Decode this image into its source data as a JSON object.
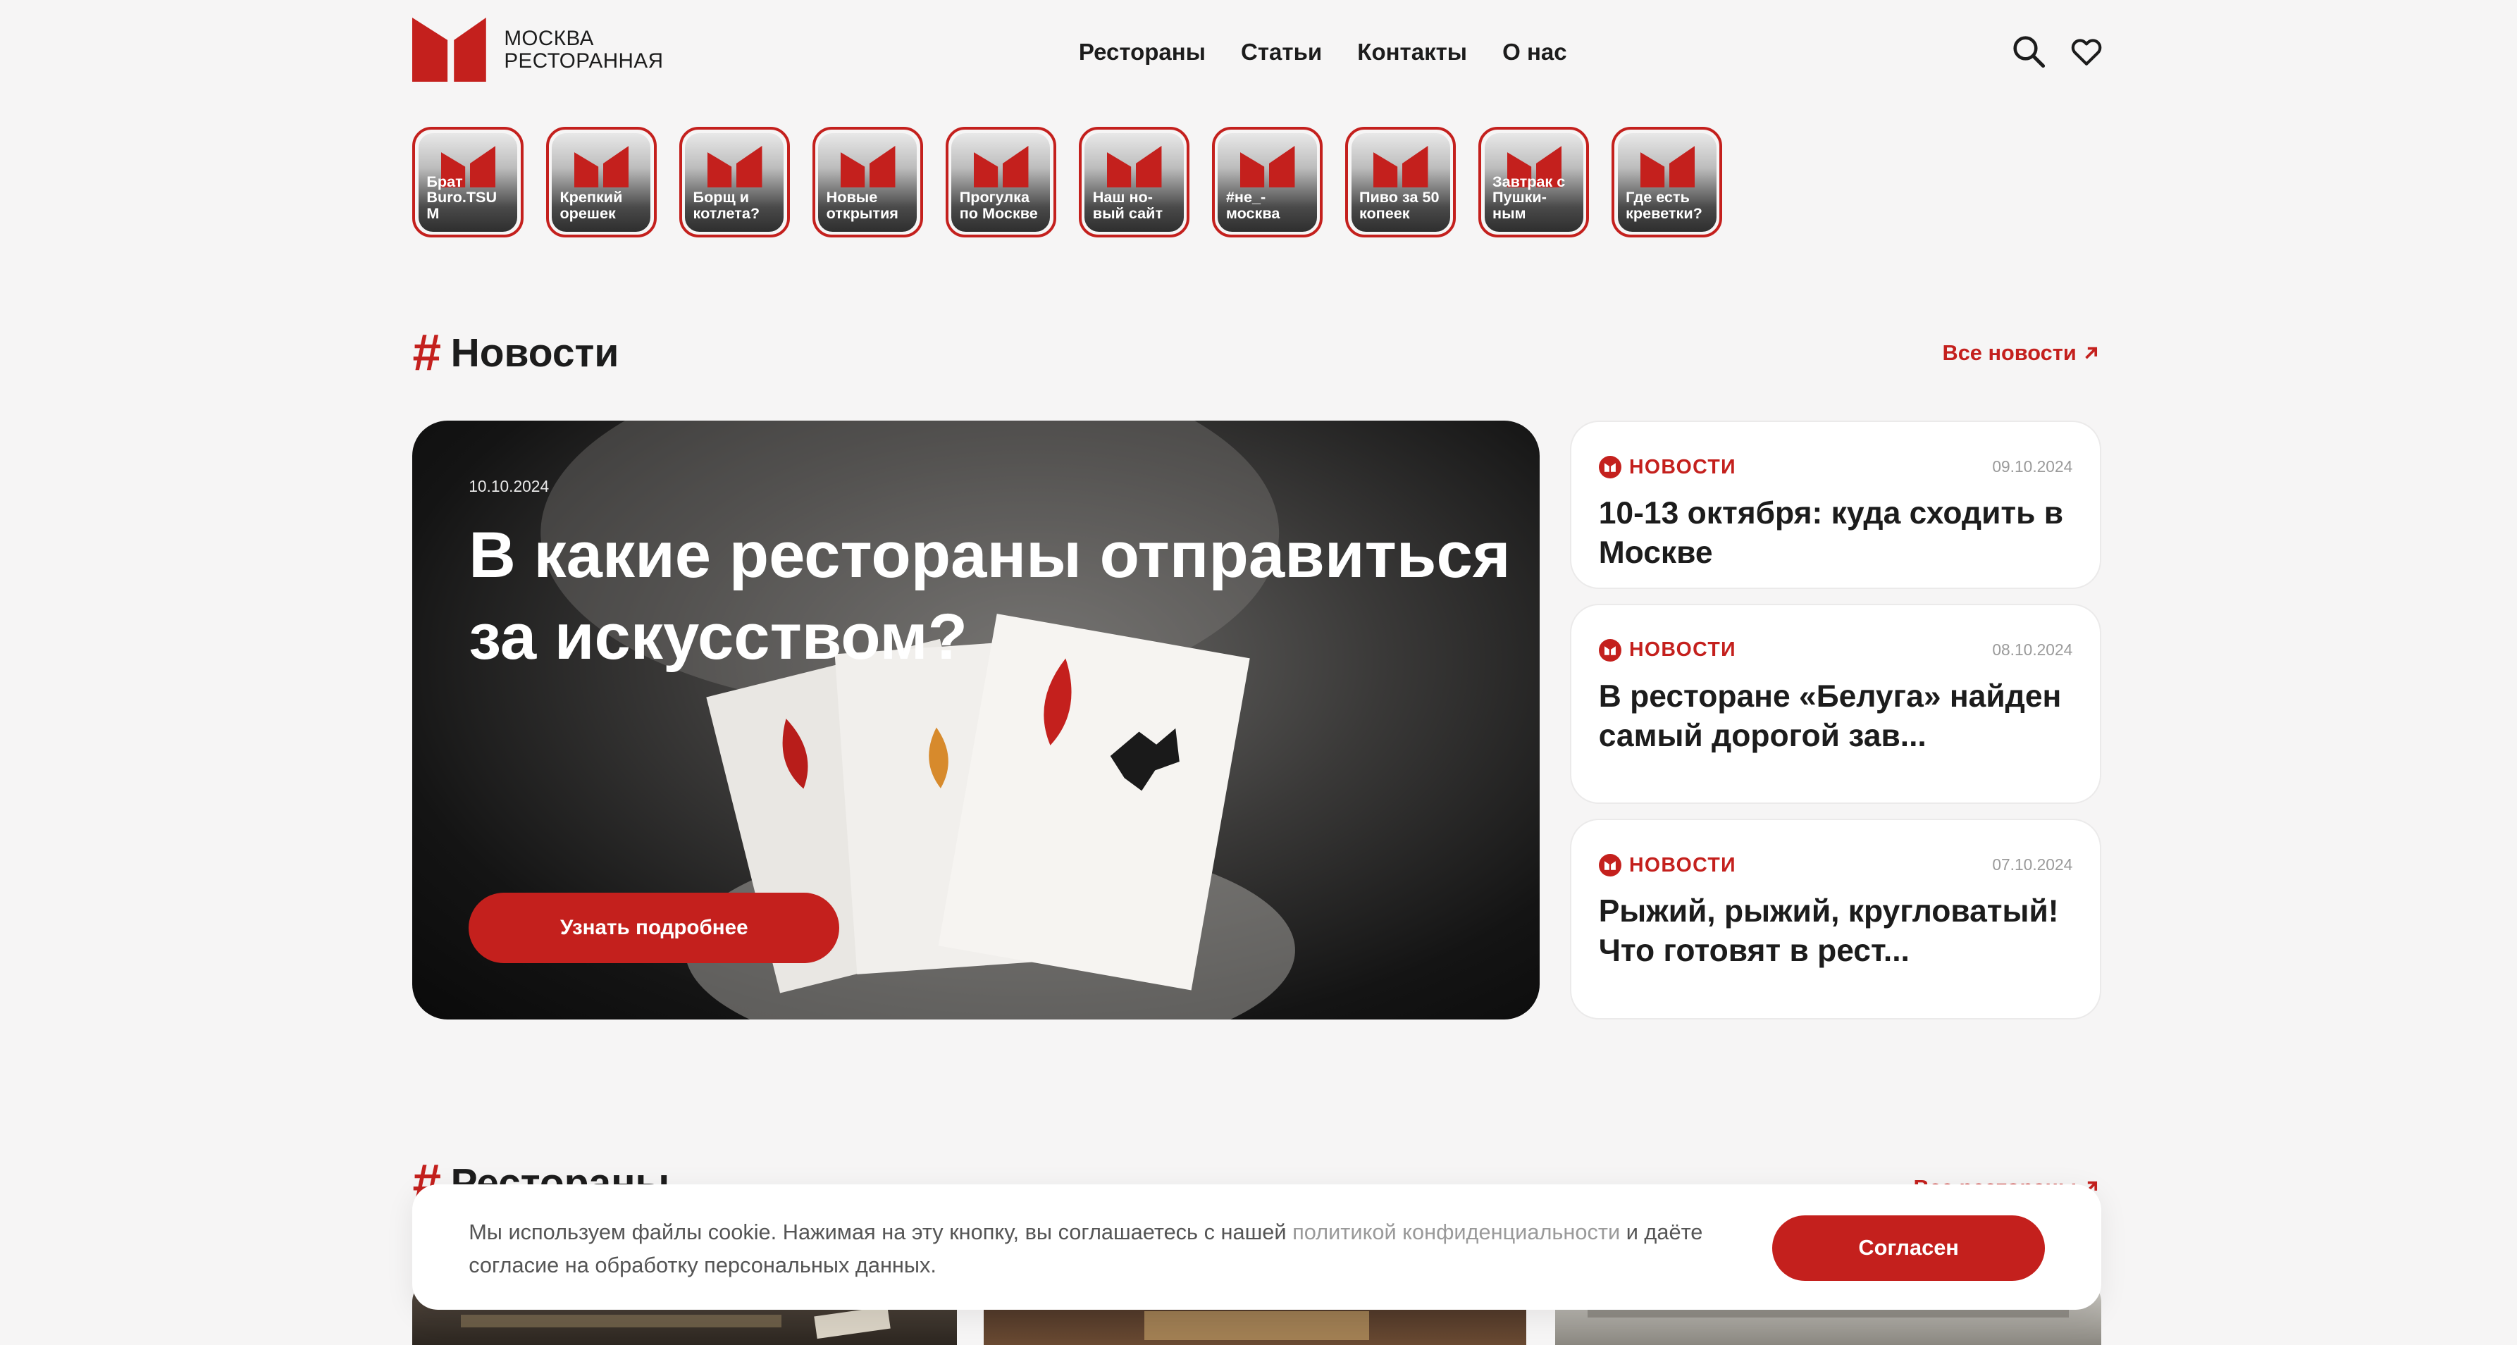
{
  "brand": {
    "name": "МОСКВА\nРЕСТОРАННАЯ",
    "accent": "#c4201d"
  },
  "nav": {
    "items": [
      "Рестораны",
      "Статьи",
      "Контакты",
      "О нас"
    ]
  },
  "header_icons": [
    "search-icon",
    "heart-icon"
  ],
  "stories": [
    "Брат\nBuro.TSU\nM",
    "Крепкий\nорешек",
    "Борщ и\nкотлета?",
    "Новые\nоткрытия",
    "Прогулка\nпо Москве",
    "Наш но-\nвый сайт",
    "#не_-\nмосква",
    "Пиво за 50\nкопеек",
    "Завтрак с\nПушки-\nным",
    "Где есть\nкреветки?"
  ],
  "news": {
    "title": "Новости",
    "all_link": "Все новости",
    "featured": {
      "date": "10.10.2024",
      "title": "В какие рестораны отправиться за искусством?",
      "button": "Узнать подробнее"
    },
    "cards": [
      {
        "tag": "НОВОСТИ",
        "date": "09.10.2024",
        "title": "10-13 октября: куда сходить в Москве"
      },
      {
        "tag": "НОВОСТИ",
        "date": "08.10.2024",
        "title": "В ресторане «Белуга» найден самый дорогой зав..."
      },
      {
        "tag": "НОВОСТИ",
        "date": "07.10.2024",
        "title": "Рыжий, рыжий, кругловатый! Что готовят в рест..."
      }
    ]
  },
  "restaurants": {
    "title": "Рестораны",
    "all_link": "Все рестораны"
  },
  "cookie": {
    "text_before": "Мы используем файлы cookie. Нажимая на эту кнопку, вы соглашаетесь с нашей ",
    "link": "политикой конфиденциальности",
    "text_after": " и даёте согласие на обработку персональных данных.",
    "button": "Согласен"
  }
}
